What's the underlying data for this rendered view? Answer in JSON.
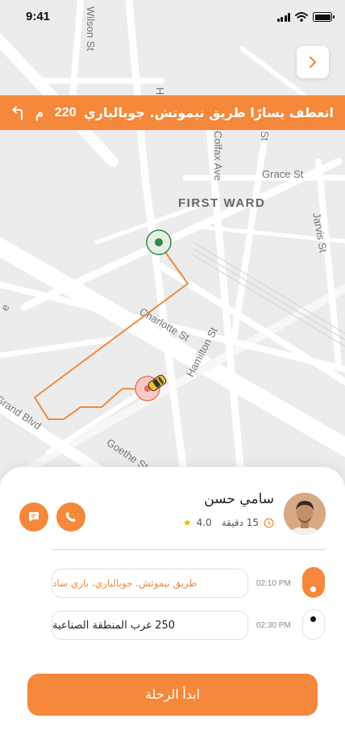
{
  "status_bar": {
    "time": "9:41"
  },
  "navigation": {
    "instruction": "انعطف يسارًا طريق نيموتش. جوبالباري",
    "distance_value": "220",
    "distance_unit": "م"
  },
  "map": {
    "streets": {
      "wilson": "Wilson St",
      "colfax": "Colfax Ave",
      "grace": "Grace St",
      "jarvis": "Jarvis St",
      "charlotte": "Charlotte St",
      "hamilton": "Hamilton St",
      "grand": "Grand Blvd",
      "goethe": "Goethe St",
      "partial_h": "H",
      "partial_st": "St",
      "partial_e": "e"
    },
    "district": "FIRST WARD",
    "route_color": "#f08a3c"
  },
  "driver": {
    "name": "سامي حسن",
    "eta": "15 دقيقة",
    "rating": "4.0"
  },
  "trip": {
    "stops": [
      {
        "time": "02:10 PM",
        "address": "طريق نيموتش. جوبالباري، باري ساد",
        "color": "#f08a3c"
      },
      {
        "time": "02:30 PM",
        "address": "250 غرب المنطقة الصناعية",
        "color": "#222222"
      }
    ]
  },
  "actions": {
    "start_trip": "ابدأ الرحلة"
  },
  "colors": {
    "accent": "#f5883a",
    "map_bg": "#ececec"
  }
}
